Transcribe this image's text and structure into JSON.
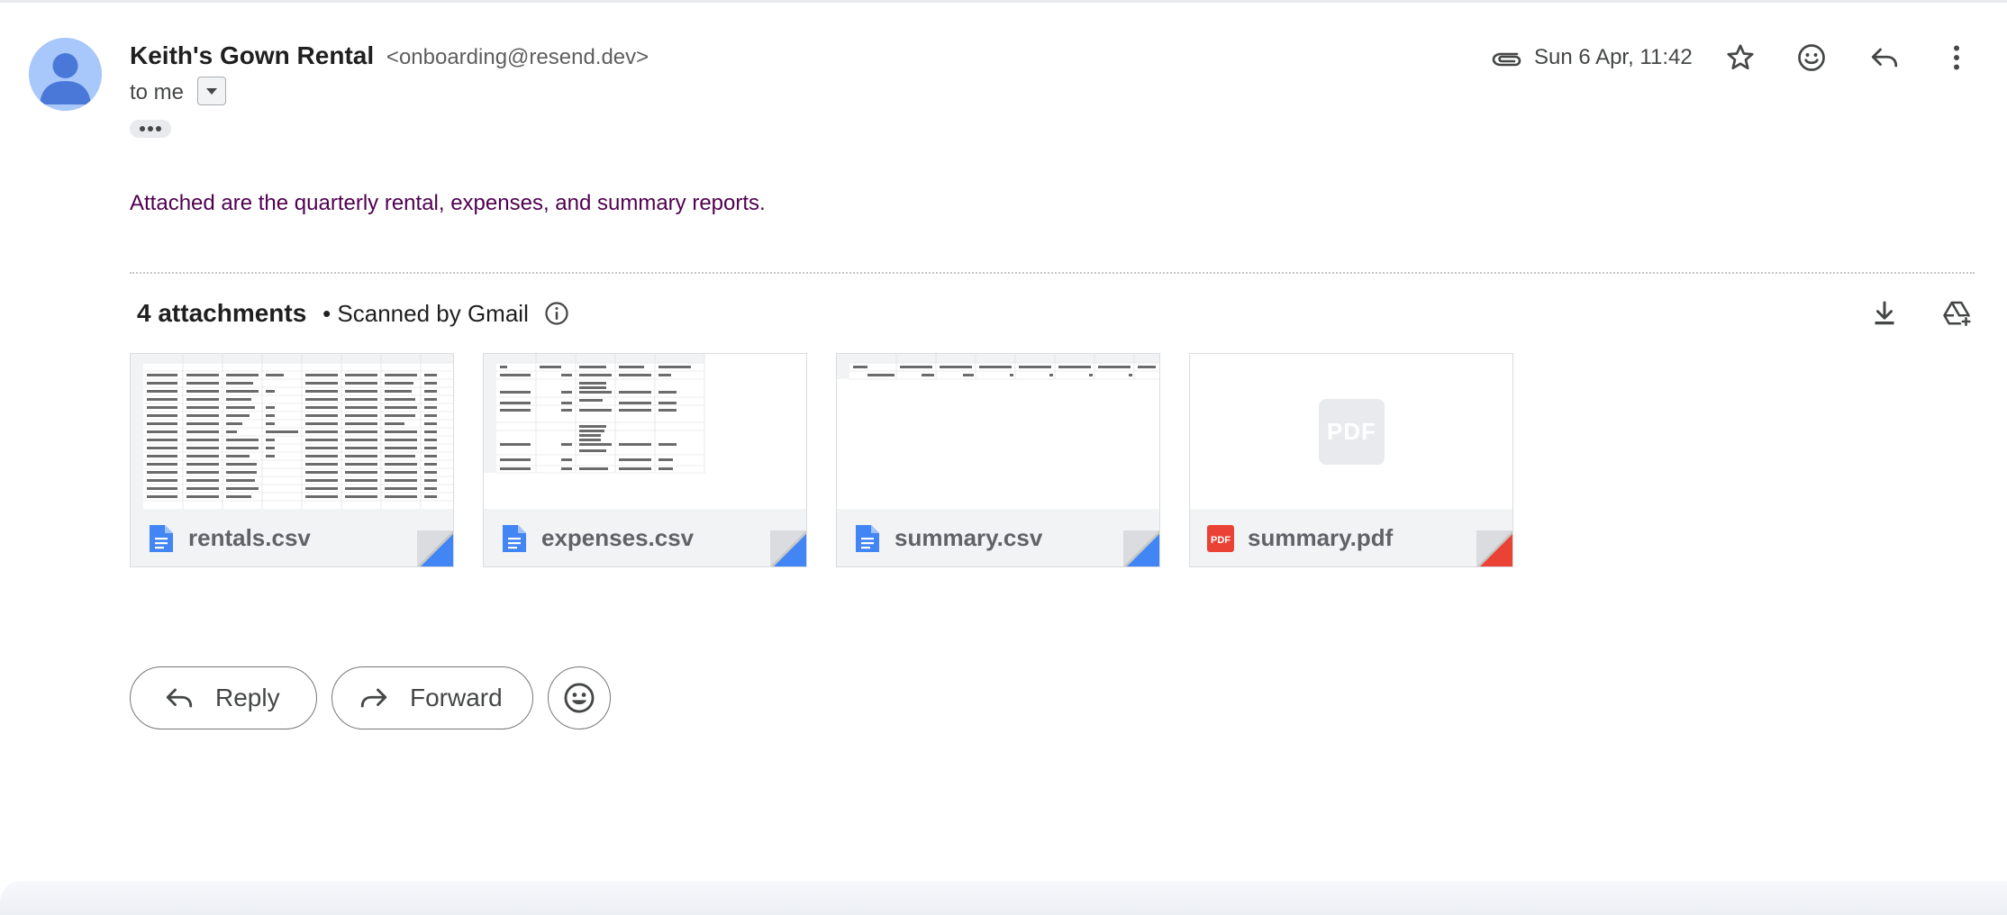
{
  "message": {
    "sender_name": "Keith's Gown Rental",
    "sender_email": "<onboarding@resend.dev>",
    "to_label": "to me",
    "date": "Sun 6 Apr, 11:42",
    "body": "Attached are the quarterly rental, expenses, and summary reports."
  },
  "attachments": {
    "count_label": "4 attachments",
    "scanned_label": "• Scanned by Gmail",
    "files": [
      {
        "name": "rentals.csv",
        "type": "csv"
      },
      {
        "name": "expenses.csv",
        "type": "csv"
      },
      {
        "name": "summary.csv",
        "type": "csv"
      },
      {
        "name": "summary.pdf",
        "type": "pdf"
      }
    ],
    "pdf_placeholder": "PDF"
  },
  "actions": {
    "reply_label": "Reply",
    "forward_label": "Forward"
  },
  "colors": {
    "avatar_bg": "#a8c7fa",
    "avatar_fg": "#4a78d8",
    "body_text": "#500050",
    "doc_blue": "#4285f4",
    "pdf_red": "#ea4335"
  },
  "icons": {
    "attachment": "paperclip-icon",
    "star": "star-icon",
    "emoji": "emoji-icon",
    "reply": "reply-icon",
    "more": "more-vert-icon",
    "download": "download-icon",
    "drive": "add-to-drive-icon",
    "info": "info-icon"
  }
}
